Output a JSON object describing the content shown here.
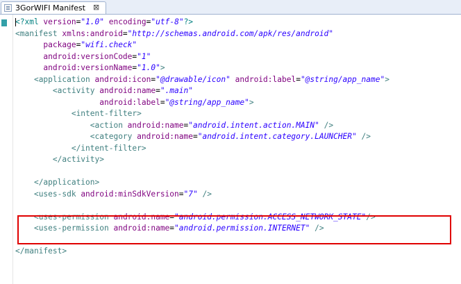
{
  "tab": {
    "title": "3GorWIFI Manifest",
    "close": "⊠"
  },
  "lines": [
    {
      "indent": "",
      "tokens": [
        {
          "t": "<?xml ",
          "c": "pi"
        },
        {
          "t": "version",
          "c": "attr"
        },
        {
          "t": "=",
          "c": "plain"
        },
        {
          "t": "\"1.0\"",
          "c": "val"
        },
        {
          "t": " ",
          "c": "plain"
        },
        {
          "t": "encoding",
          "c": "attr"
        },
        {
          "t": "=",
          "c": "plain"
        },
        {
          "t": "\"utf-8\"",
          "c": "val"
        },
        {
          "t": "?>",
          "c": "pi"
        }
      ]
    },
    {
      "indent": "",
      "tokens": [
        {
          "t": "<manifest ",
          "c": "tag"
        },
        {
          "t": "xmlns:android",
          "c": "attr"
        },
        {
          "t": "=",
          "c": "plain"
        },
        {
          "t": "\"http://schemas.android.com/apk/res/android\"",
          "c": "val"
        }
      ]
    },
    {
      "indent": "      ",
      "tokens": [
        {
          "t": "package",
          "c": "attr"
        },
        {
          "t": "=",
          "c": "plain"
        },
        {
          "t": "\"wifi.check\"",
          "c": "val"
        }
      ]
    },
    {
      "indent": "      ",
      "tokens": [
        {
          "t": "android:versionCode",
          "c": "attr"
        },
        {
          "t": "=",
          "c": "plain"
        },
        {
          "t": "\"1\"",
          "c": "val"
        }
      ]
    },
    {
      "indent": "      ",
      "tokens": [
        {
          "t": "android:versionName",
          "c": "attr"
        },
        {
          "t": "=",
          "c": "plain"
        },
        {
          "t": "\"1.0\"",
          "c": "val"
        },
        {
          "t": ">",
          "c": "tag"
        }
      ]
    },
    {
      "indent": "    ",
      "tokens": [
        {
          "t": "<application ",
          "c": "tag"
        },
        {
          "t": "android:icon",
          "c": "attr"
        },
        {
          "t": "=",
          "c": "plain"
        },
        {
          "t": "\"@drawable/icon\"",
          "c": "val"
        },
        {
          "t": " ",
          "c": "plain"
        },
        {
          "t": "android:label",
          "c": "attr"
        },
        {
          "t": "=",
          "c": "plain"
        },
        {
          "t": "\"@string/app_name\"",
          "c": "val"
        },
        {
          "t": ">",
          "c": "tag"
        }
      ]
    },
    {
      "indent": "        ",
      "tokens": [
        {
          "t": "<activity ",
          "c": "tag"
        },
        {
          "t": "android:name",
          "c": "attr"
        },
        {
          "t": "=",
          "c": "plain"
        },
        {
          "t": "\".main\"",
          "c": "val"
        }
      ]
    },
    {
      "indent": "                  ",
      "tokens": [
        {
          "t": "android:label",
          "c": "attr"
        },
        {
          "t": "=",
          "c": "plain"
        },
        {
          "t": "\"@string/app_name\"",
          "c": "val"
        },
        {
          "t": ">",
          "c": "tag"
        }
      ]
    },
    {
      "indent": "            ",
      "tokens": [
        {
          "t": "<intent-filter>",
          "c": "tag"
        }
      ]
    },
    {
      "indent": "                ",
      "tokens": [
        {
          "t": "<action ",
          "c": "tag"
        },
        {
          "t": "android:name",
          "c": "attr"
        },
        {
          "t": "=",
          "c": "plain"
        },
        {
          "t": "\"android.intent.action.MAIN\"",
          "c": "val"
        },
        {
          "t": " />",
          "c": "tag"
        }
      ]
    },
    {
      "indent": "                ",
      "tokens": [
        {
          "t": "<category ",
          "c": "tag"
        },
        {
          "t": "android:name",
          "c": "attr"
        },
        {
          "t": "=",
          "c": "plain"
        },
        {
          "t": "\"android.intent.category.LAUNCHER\"",
          "c": "val"
        },
        {
          "t": " />",
          "c": "tag"
        }
      ]
    },
    {
      "indent": "            ",
      "tokens": [
        {
          "t": "</intent-filter>",
          "c": "tag"
        }
      ]
    },
    {
      "indent": "        ",
      "tokens": [
        {
          "t": "</activity>",
          "c": "tag"
        }
      ]
    },
    {
      "indent": "",
      "tokens": []
    },
    {
      "indent": "    ",
      "tokens": [
        {
          "t": "</application>",
          "c": "tag"
        }
      ]
    },
    {
      "indent": "    ",
      "tokens": [
        {
          "t": "<uses-sdk ",
          "c": "tag"
        },
        {
          "t": "android:minSdkVersion",
          "c": "attr"
        },
        {
          "t": "=",
          "c": "plain"
        },
        {
          "t": "\"7\"",
          "c": "val"
        },
        {
          "t": " />",
          "c": "tag"
        }
      ]
    },
    {
      "indent": "",
      "tokens": []
    },
    {
      "indent": "    ",
      "tokens": [
        {
          "t": "<uses-permission ",
          "c": "tag"
        },
        {
          "t": "android:name",
          "c": "attr"
        },
        {
          "t": "=",
          "c": "plain"
        },
        {
          "t": "\"android.permission.ACCESS_NETWORK_STATE\"",
          "c": "val"
        },
        {
          "t": "/>",
          "c": "tag"
        }
      ]
    },
    {
      "indent": "    ",
      "tokens": [
        {
          "t": "<uses-permission ",
          "c": "tag"
        },
        {
          "t": "android:name",
          "c": "attr"
        },
        {
          "t": "=",
          "c": "plain"
        },
        {
          "t": "\"android.permission.INTERNET\"",
          "c": "val"
        },
        {
          "t": " />",
          "c": "tag"
        }
      ]
    },
    {
      "indent": "",
      "tokens": []
    },
    {
      "indent": "",
      "tokens": [
        {
          "t": "</manifest>",
          "c": "tag"
        }
      ]
    }
  ]
}
